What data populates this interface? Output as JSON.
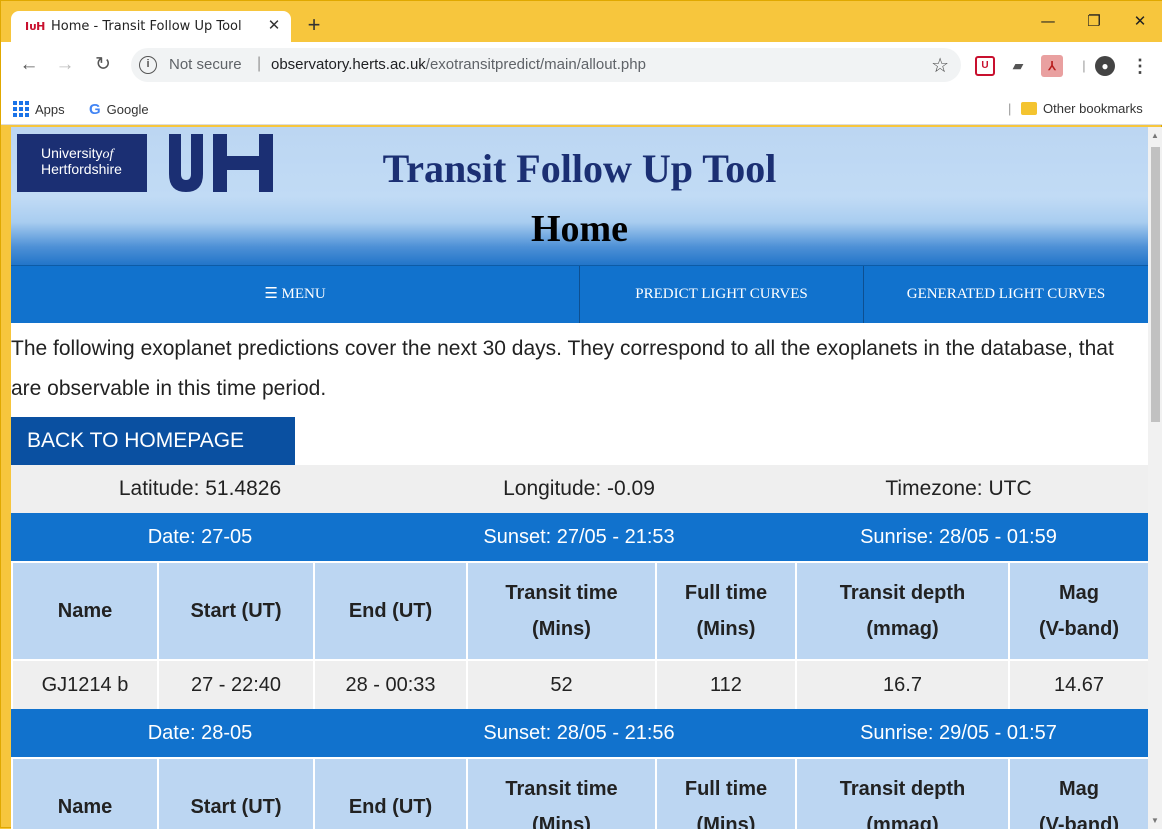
{
  "browser": {
    "tab_title": "Home - Transit Follow Up Tool",
    "tab_favicon": "IᴏH",
    "url_status": "Not secure",
    "url_host": "observatory.herts.ac.uk",
    "url_path": "/exotransitpredict/main/allout.php",
    "bookmarks": {
      "apps": "Apps",
      "google": "Google",
      "other": "Other bookmarks"
    }
  },
  "header": {
    "logo_line1": "University",
    "logo_of": "of",
    "logo_line2": "Hertfordshire",
    "title": "Transit Follow Up Tool",
    "subtitle": "Home"
  },
  "nav": {
    "menu": "MENU",
    "predict": "PREDICT LIGHT CURVES",
    "generated": "GENERATED LIGHT CURVES"
  },
  "intro_text": "The following exoplanet predictions cover the next 30 days. They correspond to all the exoplanets in the database, that are observable in this time period.",
  "back_button": "BACK TO HOMEPAGE",
  "location": {
    "latitude": "Latitude: 51.4826",
    "longitude": "Longitude: -0.09",
    "timezone": "Timezone: UTC"
  },
  "table_headers": {
    "name": "Name",
    "start": "Start (UT)",
    "end": "End (UT)",
    "transit_time_1": "Transit time",
    "transit_time_2": "(Mins)",
    "full_time_1": "Full time",
    "full_time_2": "(Mins)",
    "depth_1": "Transit depth",
    "depth_2": "(mmag)",
    "mag_1": "Mag",
    "mag_2": "(V-band)"
  },
  "days": [
    {
      "date": "Date: 27-05",
      "sunset": "Sunset: 27/05 - 21:53",
      "sunrise": "Sunrise: 28/05 - 01:59",
      "rows": [
        {
          "name": "GJ1214 b",
          "start": "27 - 22:40",
          "end": "28 - 00:33",
          "transit": "52",
          "full": "112",
          "depth": "16.7",
          "mag": "14.67"
        }
      ]
    },
    {
      "date": "Date: 28-05",
      "sunset": "Sunset: 28/05 - 21:56",
      "sunrise": "Sunrise: 29/05 - 01:57",
      "rows": []
    }
  ]
}
